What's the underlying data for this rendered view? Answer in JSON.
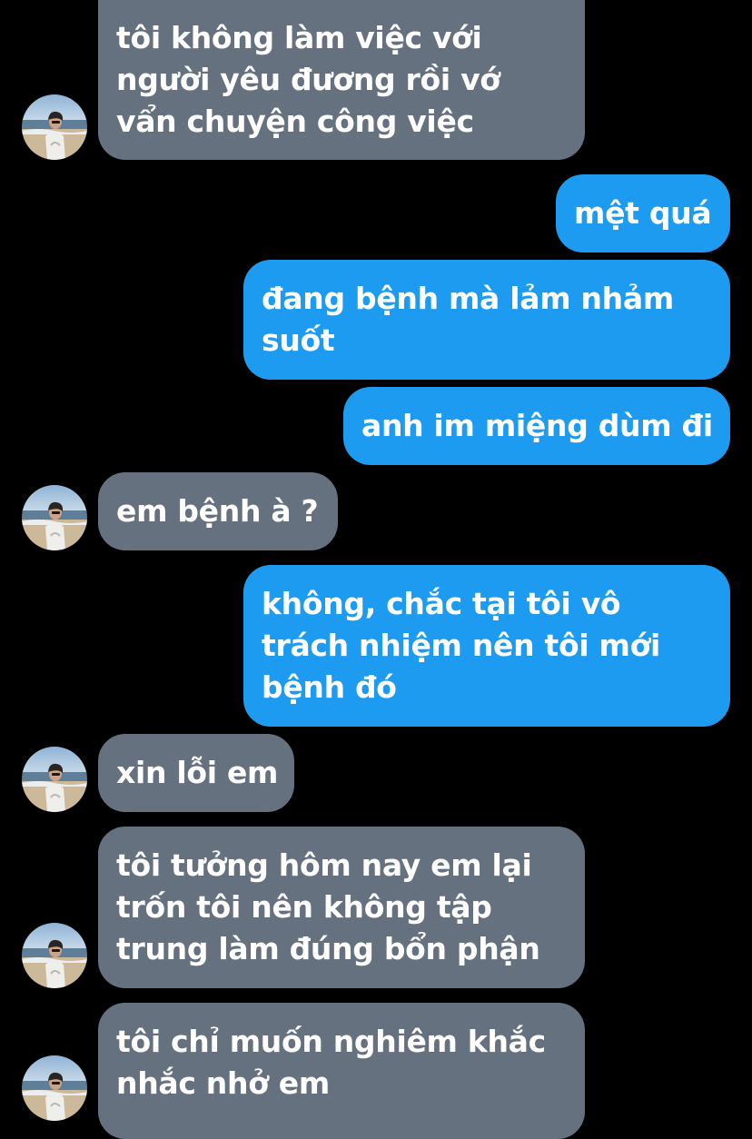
{
  "messages": [
    {
      "side": "incoming",
      "avatar": true,
      "lines": [
        "tôi không làm việc với",
        "người yêu đương rồi vớ",
        "vẩn chuyện công việc"
      ]
    },
    {
      "side": "outgoing",
      "avatar": false,
      "lines": [
        "mệt quá"
      ]
    },
    {
      "side": "outgoing",
      "avatar": false,
      "lines": [
        "đang bệnh mà lảm nhảm",
        "suốt"
      ]
    },
    {
      "side": "outgoing",
      "avatar": false,
      "lines": [
        "anh im miệng dùm đi"
      ]
    },
    {
      "side": "incoming",
      "avatar": true,
      "lines": [
        "em bệnh à ?"
      ]
    },
    {
      "side": "outgoing",
      "avatar": false,
      "lines": [
        "không, chắc tại tôi vô",
        "trách nhiệm nên tôi mới",
        "bệnh đó"
      ]
    },
    {
      "side": "incoming",
      "avatar": true,
      "lines": [
        "xin lỗi em"
      ]
    },
    {
      "side": "incoming",
      "avatar": true,
      "lines": [
        "tôi tưởng hôm nay em lại",
        "trốn tôi nên không tập",
        "trung làm đúng bổn phận"
      ]
    },
    {
      "side": "incoming",
      "avatar": true,
      "lines": [
        "tôi chỉ muốn nghiêm khắc",
        "nhắc nhở em"
      ]
    }
  ],
  "colors": {
    "background": "#000000",
    "incoming_bubble": "#66717f",
    "outgoing_bubble": "#1d9bf0",
    "text": "#ffffff"
  },
  "icons": {
    "avatar": "profile-photo-avatar"
  }
}
